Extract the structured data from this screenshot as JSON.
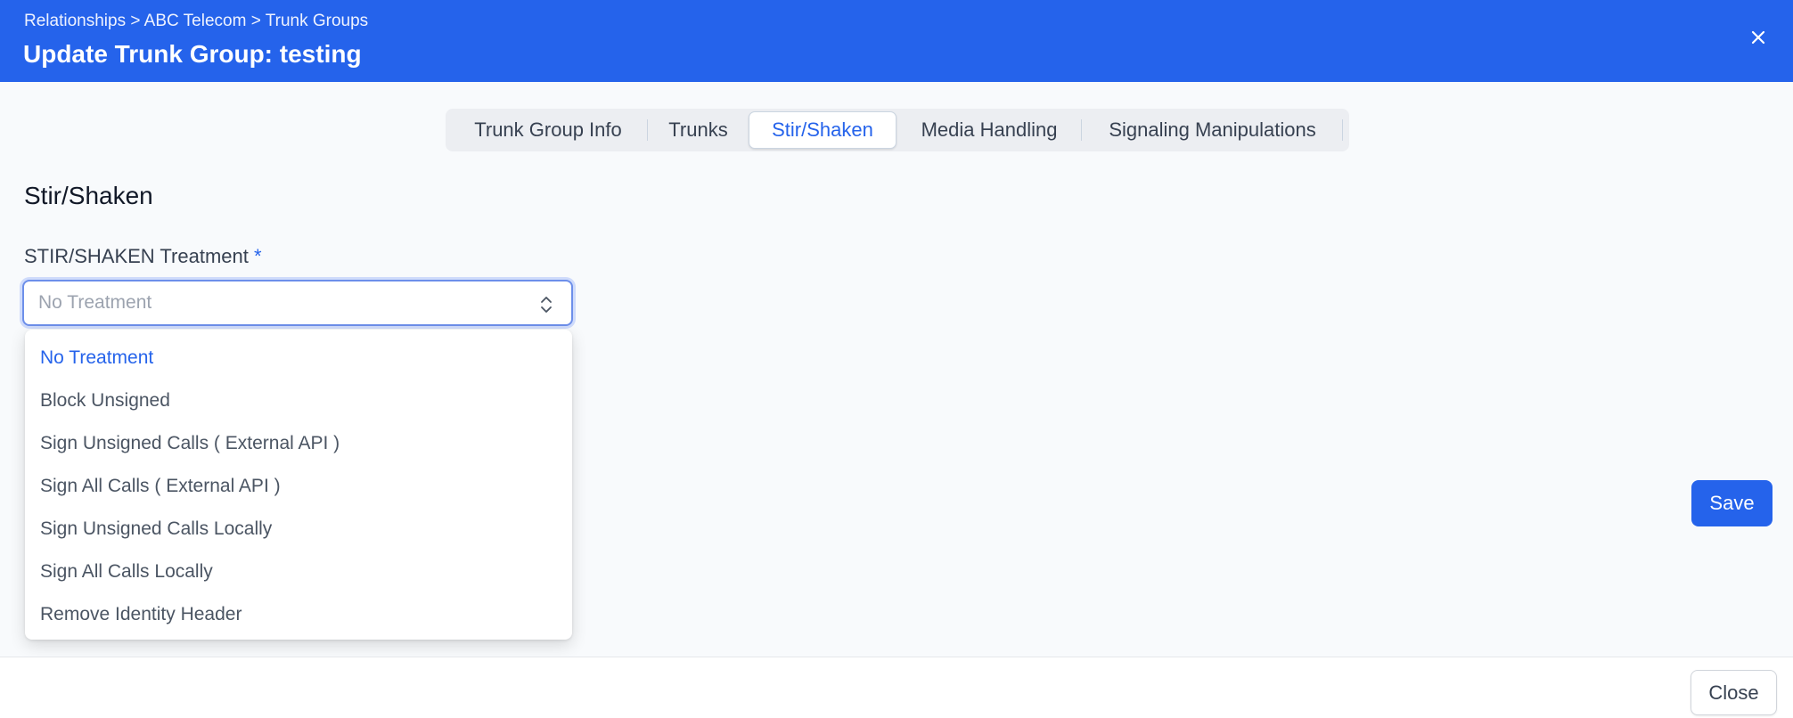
{
  "header": {
    "breadcrumb": "Relationships > ABC Telecom > Trunk Groups",
    "title": "Update Trunk Group: testing",
    "close_icon": "close-icon"
  },
  "tabs": [
    {
      "label": "Trunk Group Info",
      "active": false
    },
    {
      "label": "Trunks",
      "active": false
    },
    {
      "label": "Stir/Shaken",
      "active": true
    },
    {
      "label": "Media Handling",
      "active": false
    },
    {
      "label": "Signaling Manipulations",
      "active": false
    }
  ],
  "section": {
    "title": "Stir/Shaken",
    "field_label": "STIR/SHAKEN Treatment",
    "required_marker": "*",
    "select_placeholder": "No Treatment",
    "options": [
      "No Treatment",
      "Block Unsigned",
      "Sign Unsigned Calls ( External API )",
      "Sign All Calls ( External API )",
      "Sign Unsigned Calls Locally",
      "Sign All Calls Locally",
      "Remove Identity Header"
    ],
    "selected_option": "No Treatment"
  },
  "actions": {
    "save_label": "Save",
    "close_label": "Close"
  },
  "colors": {
    "accent": "#2563eb",
    "background": "#f8fafc"
  }
}
